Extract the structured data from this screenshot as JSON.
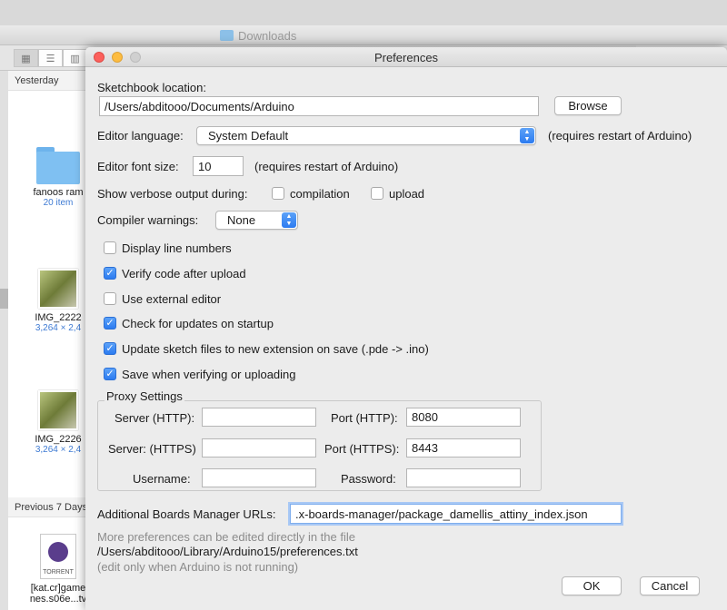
{
  "finder": {
    "title": "Downloads",
    "view_buttons": [
      "icon-view",
      "list-view",
      "column-view"
    ],
    "sections": [
      {
        "header": "Yesterday"
      },
      {
        "header": "Previous 7 Days"
      }
    ],
    "items": [
      {
        "name": "fanoos ram",
        "sub": "20 item"
      },
      {
        "name": "IMG_2222",
        "sub": "3,264 × 2,4"
      },
      {
        "name": "IMG_2226",
        "sub": "3,264 × 2,4"
      },
      {
        "name": "[kat.cr]game",
        "name2": "nes.s06e...tv",
        "icon_text": "TORRENT"
      }
    ]
  },
  "prefs": {
    "title": "Preferences",
    "sketchbook_label": "Sketchbook location:",
    "sketchbook_path": "/Users/abditooo/Documents/Arduino",
    "browse_label": "Browse",
    "editor_language_label": "Editor language:",
    "editor_language_value": "System Default",
    "editor_language_note": "(requires restart of Arduino)",
    "font_size_label": "Editor font size:",
    "font_size_value": "10",
    "font_size_note": "(requires restart of Arduino)",
    "verbose_label": "Show verbose output during:",
    "verbose_compilation": {
      "label": "compilation",
      "checked": false
    },
    "verbose_upload": {
      "label": "upload",
      "checked": false
    },
    "compiler_warnings_label": "Compiler warnings:",
    "compiler_warnings_value": "None",
    "options": [
      {
        "label": "Display line numbers",
        "checked": false
      },
      {
        "label": "Verify code after upload",
        "checked": true
      },
      {
        "label": "Use external editor",
        "checked": false
      },
      {
        "label": "Check for updates on startup",
        "checked": true
      },
      {
        "label": "Update sketch files to new extension on save (.pde -> .ino)",
        "checked": true
      },
      {
        "label": "Save when verifying or uploading",
        "checked": true
      }
    ],
    "proxy": {
      "legend": "Proxy Settings",
      "server_http_label": "Server (HTTP):",
      "server_http_value": "",
      "port_http_label": "Port (HTTP):",
      "port_http_value": "8080",
      "server_https_label": "Server: (HTTPS)",
      "server_https_value": "",
      "port_https_label": "Port (HTTPS):",
      "port_https_value": "8443",
      "username_label": "Username:",
      "username_value": "",
      "password_label": "Password:",
      "password_value": ""
    },
    "boards_urls_label": "Additional Boards Manager URLs:",
    "boards_urls_value": ".x-boards-manager/package_damellis_attiny_index.json",
    "more_prefs_note": "More preferences can be edited directly in the file",
    "prefs_file_path": "/Users/abditooo/Library/Arduino15/preferences.txt",
    "edit_note": "(edit only when Arduino is not running)",
    "ok_label": "OK",
    "cancel_label": "Cancel",
    "accent_color": "#2c7bf0"
  }
}
